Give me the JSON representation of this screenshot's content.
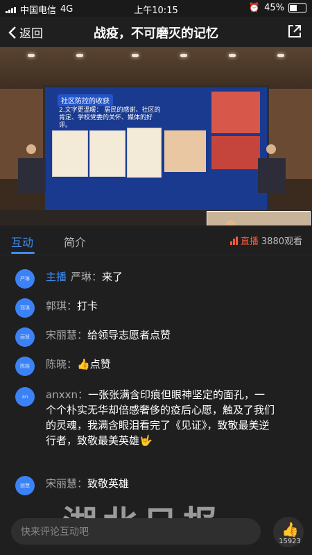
{
  "status_bar": {
    "carrier": "中国电信",
    "network": "4G",
    "time": "上午10:15",
    "battery": "45%"
  },
  "nav": {
    "back_label": "返回",
    "title": "战疫，不可磨灭的记忆",
    "share_icon": "share-icon"
  },
  "video": {
    "slide_header": "社区防控的收获",
    "slide_body": "2.文字更温暖：\n居民的感谢、社区的肯定、学校党委的关怀、媒体的好评。"
  },
  "tabs": {
    "interaction": "互动",
    "intro": "简介",
    "live_label": "直播",
    "viewers": "3880观看"
  },
  "comments": [
    {
      "avatar": "严琳",
      "badge": "主播",
      "name": "严琳：",
      "text": "来了"
    },
    {
      "avatar": "郭琪",
      "badge": "",
      "name": "郭琪：",
      "text": "打卡"
    },
    {
      "avatar": "丽慧",
      "badge": "",
      "name": "宋丽慧：",
      "text": "给领导志愿者点赞"
    },
    {
      "avatar": "陈晓",
      "badge": "",
      "name": "陈晓：",
      "text": "👍点赞"
    },
    {
      "avatar": "an",
      "badge": "",
      "name": "anxxn：",
      "text": "一张张满含印痕但眼神坚定的面孔，一个个朴实无华却倍感奢侈的疫后心愿，触及了我们的灵魂，我满含眼泪看完了《见证》，致敬最美逆行者，致敬最美英雄🤟"
    },
    {
      "avatar": "丽慧",
      "badge": "",
      "name": "宋丽慧：",
      "text": "致敬英雄"
    }
  ],
  "input": {
    "placeholder": "快来评论互动吧"
  },
  "like": {
    "count": "15923"
  },
  "watermark": "湖北日报",
  "colors": {
    "accent": "#3e8df3",
    "live": "#ff5a3c",
    "background": "#1f1f1f"
  }
}
